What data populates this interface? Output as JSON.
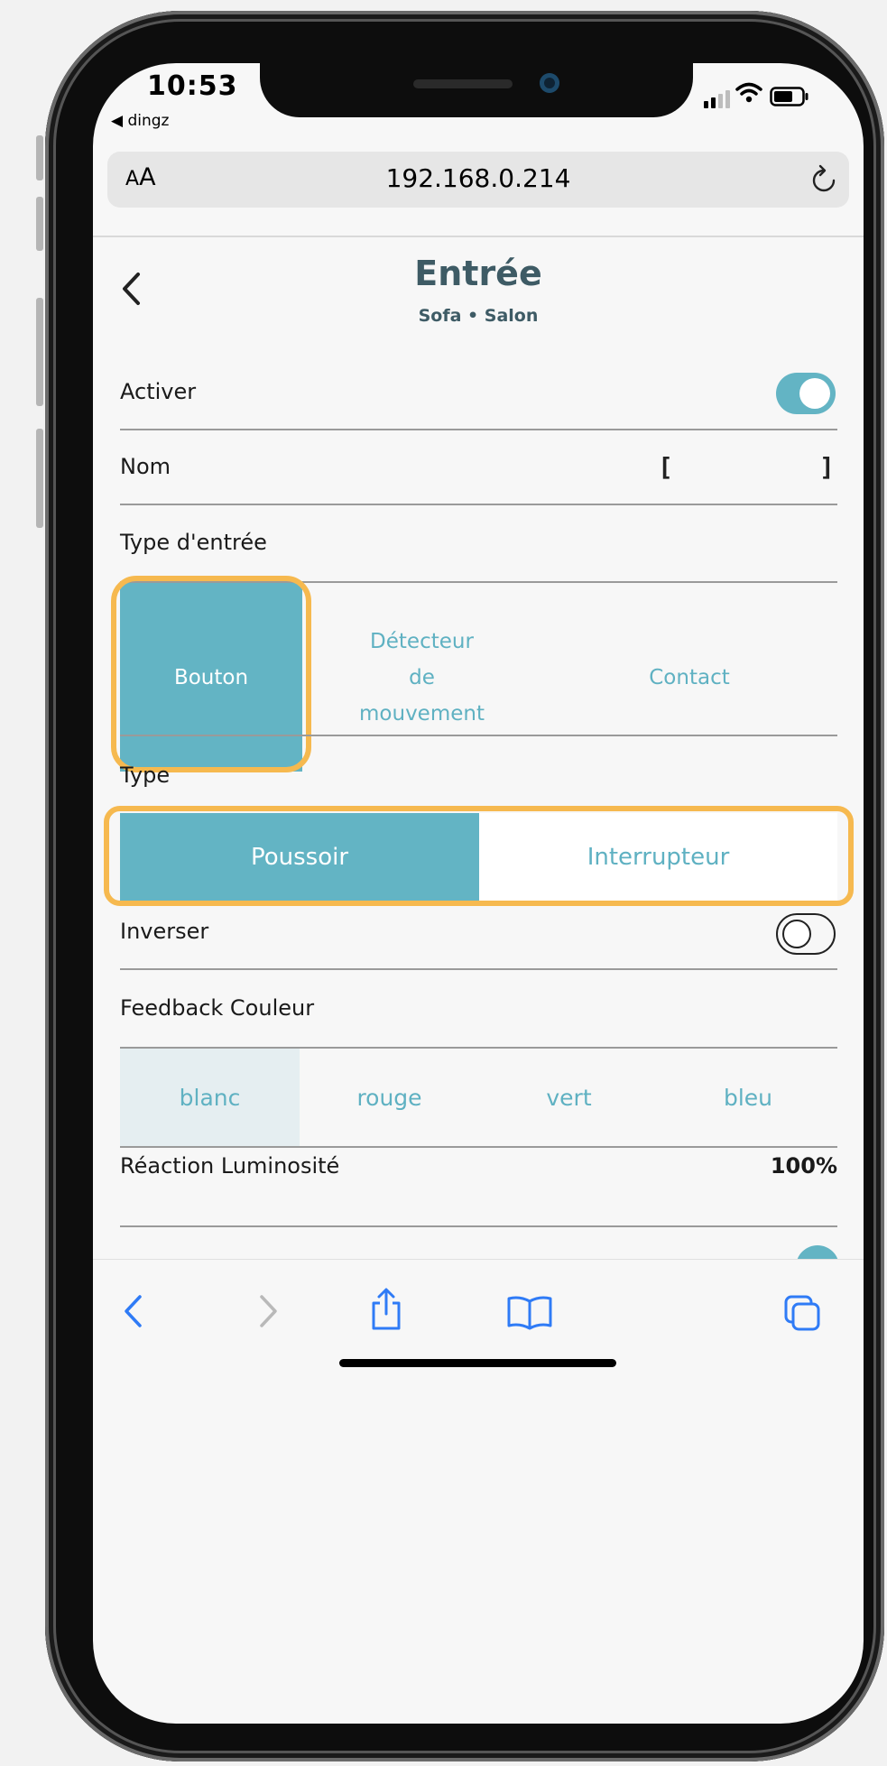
{
  "status_bar": {
    "time": "10:53",
    "back_app": "◀ dingz"
  },
  "browser": {
    "text_size_small": "A",
    "text_size_large": "A",
    "url": "192.168.0.214"
  },
  "header": {
    "title": "Entrée",
    "subtitle": "Sofa • Salon"
  },
  "activer": {
    "label": "Activer",
    "enabled": true
  },
  "nom": {
    "label": "Nom",
    "bracket_open": "[",
    "bracket_close": "]",
    "value": ""
  },
  "input_type": {
    "label": "Type d'entrée",
    "options": [
      {
        "label": "Bouton",
        "selected": true
      },
      {
        "label": "Détecteur de mouvement",
        "line1": "Détecteur",
        "line2": "de",
        "line3": "mouvement",
        "selected": false
      },
      {
        "label": "Contact",
        "selected": false
      }
    ]
  },
  "type": {
    "label": "Type",
    "options": [
      {
        "label": "Poussoir",
        "selected": true
      },
      {
        "label": "Interrupteur",
        "selected": false
      }
    ]
  },
  "inverser": {
    "label": "Inverser",
    "enabled": false
  },
  "feedback": {
    "label": "Feedback Couleur",
    "options": [
      {
        "label": "blanc",
        "selected": true
      },
      {
        "label": "rouge",
        "selected": false
      },
      {
        "label": "vert",
        "selected": false
      },
      {
        "label": "bleu",
        "selected": false
      }
    ]
  },
  "luminosite": {
    "label": "Réaction Luminosité",
    "value_text": "100%",
    "value": 1.0
  },
  "toolbar": {
    "icons": [
      "back-icon",
      "forward-icon",
      "share-icon",
      "bookmarks-icon",
      "tabs-icon"
    ]
  },
  "colors": {
    "accent": "#63b4c4",
    "title": "#3e5b65",
    "highlight": "#f6b94f"
  }
}
